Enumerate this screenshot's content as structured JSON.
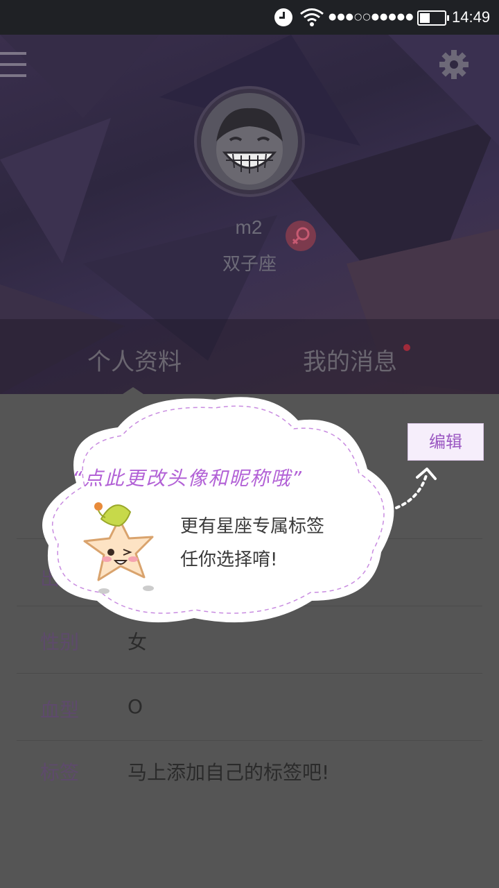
{
  "status_bar": {
    "time": "14:49",
    "signal": "●●●○○●●●●●",
    "icons": [
      "clock-icon",
      "wifi-icon",
      "battery-icon"
    ]
  },
  "header": {
    "menu_icon": "menu-icon",
    "settings_icon": "gear-icon",
    "username": "m2",
    "zodiac": "双子座",
    "gender_icon": "female-icon"
  },
  "tabs": [
    {
      "label": "个人资料",
      "active": true
    },
    {
      "label": "我的消息",
      "has_notification": true
    }
  ],
  "edit_button": {
    "label": "编辑"
  },
  "tooltip": {
    "title": "“点此更改头像和昵称哦”",
    "line1": "更有星座专属标签",
    "line2": "任你选择唷!"
  },
  "profile_rows": [
    {
      "label": "出",
      "value": ""
    },
    {
      "label": "性别",
      "value": "女"
    },
    {
      "label": "血型",
      "value": "O"
    },
    {
      "label": "标签",
      "value": "马上添加自己的标签吧!"
    }
  ],
  "colors": {
    "accent": "#9b58c2",
    "tooltip_title": "#b261d6",
    "notification_dot": "#a02a3a"
  }
}
